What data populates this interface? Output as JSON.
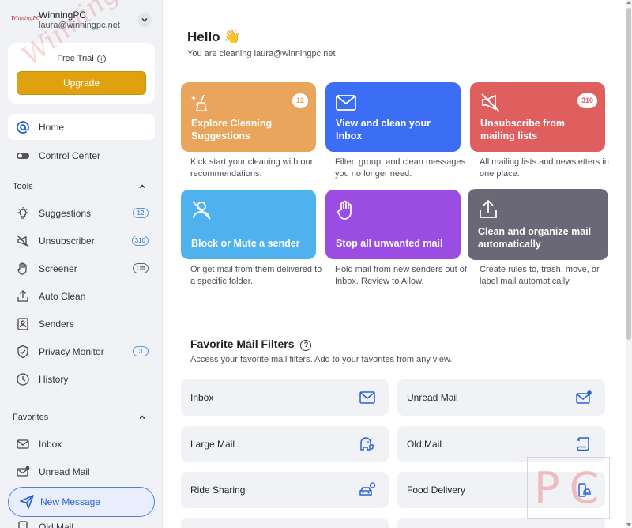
{
  "account": {
    "brand": "WinningPC",
    "name": "WinningPC",
    "email": "laura@winningpc.net"
  },
  "trial": {
    "label": "Free Trial",
    "upgrade_label": "Upgrade"
  },
  "sidebar": {
    "main_items": [
      {
        "label": "Home"
      },
      {
        "label": "Control Center"
      }
    ],
    "tools_label": "Tools",
    "tools": [
      {
        "label": "Suggestions",
        "badge": "12"
      },
      {
        "label": "Unsubscriber",
        "badge": "310"
      },
      {
        "label": "Screener",
        "badge": "Off"
      },
      {
        "label": "Auto Clean"
      },
      {
        "label": "Senders"
      },
      {
        "label": "Privacy Monitor",
        "badge": "3"
      },
      {
        "label": "History"
      }
    ],
    "favorites_label": "Favorites",
    "favorites": [
      {
        "label": "Inbox"
      },
      {
        "label": "Unread Mail"
      },
      {
        "label": "Old Mail"
      }
    ],
    "new_message_label": "New Message"
  },
  "main": {
    "hello": "Hello 👋",
    "subtitle": "You are cleaning laura@winningpc.net",
    "cards": [
      {
        "title": "Explore Cleaning Suggestions",
        "badge": "12",
        "desc": "Kick start your cleaning with our recommendations.",
        "color": "#eaa55c"
      },
      {
        "title": "View and clean your Inbox",
        "desc": "Filter, group, and clean messages you no longer need.",
        "color": "#3b6ef5"
      },
      {
        "title": "Unsubscribe from mailing lists",
        "badge": "310",
        "desc": "All mailing lists and newsletters in one place.",
        "color": "#df5f5f"
      },
      {
        "title": "Block or Mute a sender",
        "desc": "Or get mail from them delivered to a specific folder.",
        "color": "#4fb1ee"
      },
      {
        "title": "Stop all unwanted mail",
        "desc": "Hold mail from new senders out of Inbox. Review to Allow.",
        "color": "#9b4de3"
      },
      {
        "title": "Clean and organize mail automatically",
        "desc": "Create rules to, trash, move, or label mail automatically.",
        "color": "#6a6876"
      }
    ],
    "favorites_title": "Favorite Mail Filters",
    "favorites_sub": "Access your favorite mail filters. Add to your favorites from any view.",
    "filters": [
      {
        "label": "Inbox",
        "icon": "inbox-icon"
      },
      {
        "label": "Unread Mail",
        "icon": "unread-mail-icon"
      },
      {
        "label": "Large Mail",
        "icon": "elephant-icon"
      },
      {
        "label": "Old Mail",
        "icon": "scroll-icon"
      },
      {
        "label": "Ride Sharing",
        "icon": "car-icon"
      },
      {
        "label": "Food Delivery",
        "icon": "food-delivery-icon"
      }
    ]
  },
  "watermark": {
    "left": "WinningPC",
    "right": "PC"
  },
  "colors": {
    "accent": "#3b6ef5",
    "upgrade": "#e0a10f",
    "sidebar_bg": "#f1f2f5"
  }
}
